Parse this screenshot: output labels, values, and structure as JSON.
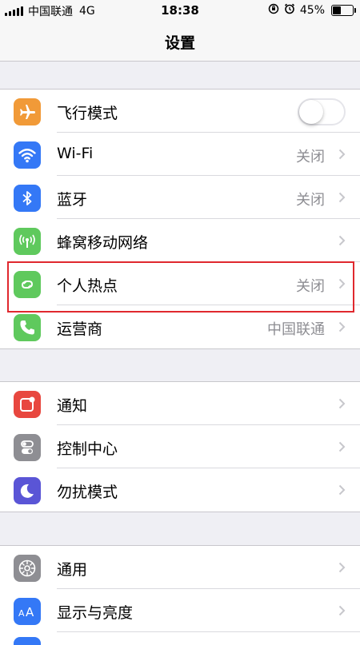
{
  "status_bar": {
    "carrier": "中国联通",
    "network": "4G",
    "time": "18:38",
    "battery_percent": "45%",
    "battery_level": 0.45
  },
  "nav": {
    "title": "设置"
  },
  "groups": [
    {
      "items": [
        {
          "label": "飞行模式",
          "icon": "airplane-icon",
          "icon_color": "#f19a38",
          "toggle_on": false
        },
        {
          "label": "Wi-Fi",
          "icon": "wifi-icon",
          "icon_color": "#3478f6",
          "value": "关闭"
        },
        {
          "label": "蓝牙",
          "icon": "bluetooth-icon",
          "icon_color": "#3478f6",
          "value": "关闭"
        },
        {
          "label": "蜂窝移动网络",
          "icon": "antenna-icon",
          "icon_color": "#5fc95d",
          "value": ""
        },
        {
          "label": "个人热点",
          "icon": "hotspot-icon",
          "icon_color": "#5fc95d",
          "value": "关闭"
        },
        {
          "label": "运营商",
          "icon": "phone-icon",
          "icon_color": "#5fc95d",
          "value": "中国联通"
        }
      ]
    },
    {
      "items": [
        {
          "label": "通知",
          "icon": "notification-icon",
          "icon_color": "#e8473f"
        },
        {
          "label": "控制中心",
          "icon": "control-center-icon",
          "icon_color": "#8e8e93"
        },
        {
          "label": "勿扰模式",
          "icon": "moon-icon",
          "icon_color": "#5a55d6"
        }
      ]
    },
    {
      "items": [
        {
          "label": "通用",
          "icon": "gear-icon",
          "icon_color": "#8e8e93"
        },
        {
          "label": "显示与亮度",
          "icon": "text-size-icon",
          "icon_color": "#3478f6"
        }
      ]
    }
  ],
  "highlight_color": "#e0282e"
}
